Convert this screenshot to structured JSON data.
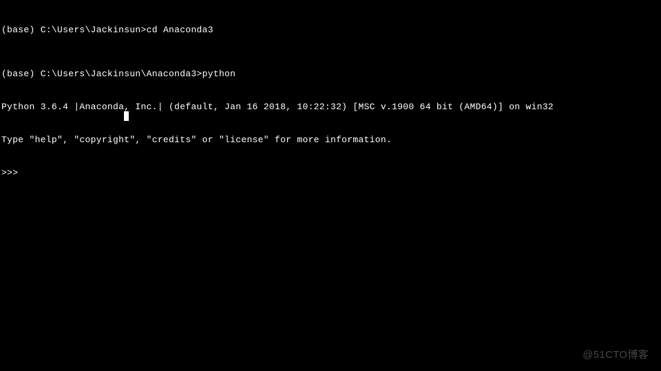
{
  "terminal": {
    "line1_prompt": "(base) C:\\Users\\Jackinsun>",
    "line1_cmd": "cd Anaconda3",
    "line2_prompt": "(base) C:\\Users\\Jackinsun\\Anaconda3>",
    "line2_cmd": "python",
    "line3": "Python 3.6.4 |Anaconda, Inc.| (default, Jan 16 2018, 10:22:32) [MSC v.1900 64 bit (AMD64)] on win32",
    "line4": "Type \"help\", \"copyright\", \"credits\" or \"license\" for more information.",
    "line5_prompt": ">>> "
  },
  "watermark": "@51CTO博客"
}
